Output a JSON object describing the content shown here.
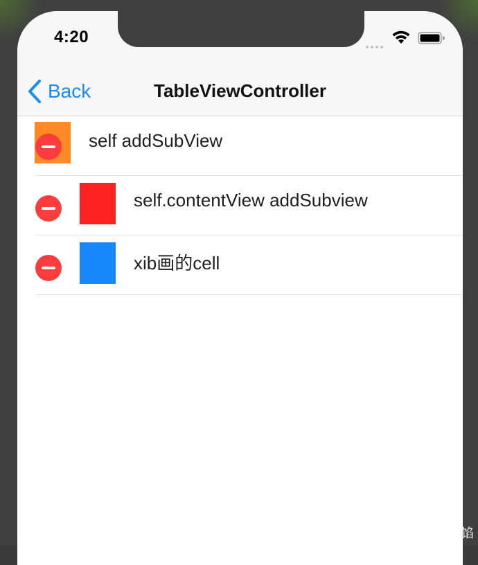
{
  "status_bar": {
    "time": "4:20"
  },
  "nav": {
    "back_label": "Back",
    "title": "TableViewController"
  },
  "rows": [
    {
      "label": "self addSubView",
      "thumb_color": "#fe8a27"
    },
    {
      "label": "self.contentView addSubview",
      "thumb_color": "#fd2121"
    },
    {
      "label": "xib画的cell",
      "thumb_color": "#1788fc"
    }
  ],
  "colors": {
    "tint": "#1a8cf5",
    "delete": "#fa3c3c"
  },
  "icons": {
    "back": "chevron-left-icon",
    "wifi": "wifi-icon",
    "battery": "battery-icon",
    "delete": "minus-circle-icon"
  },
  "watermark": "@这个汤圆没有馅"
}
